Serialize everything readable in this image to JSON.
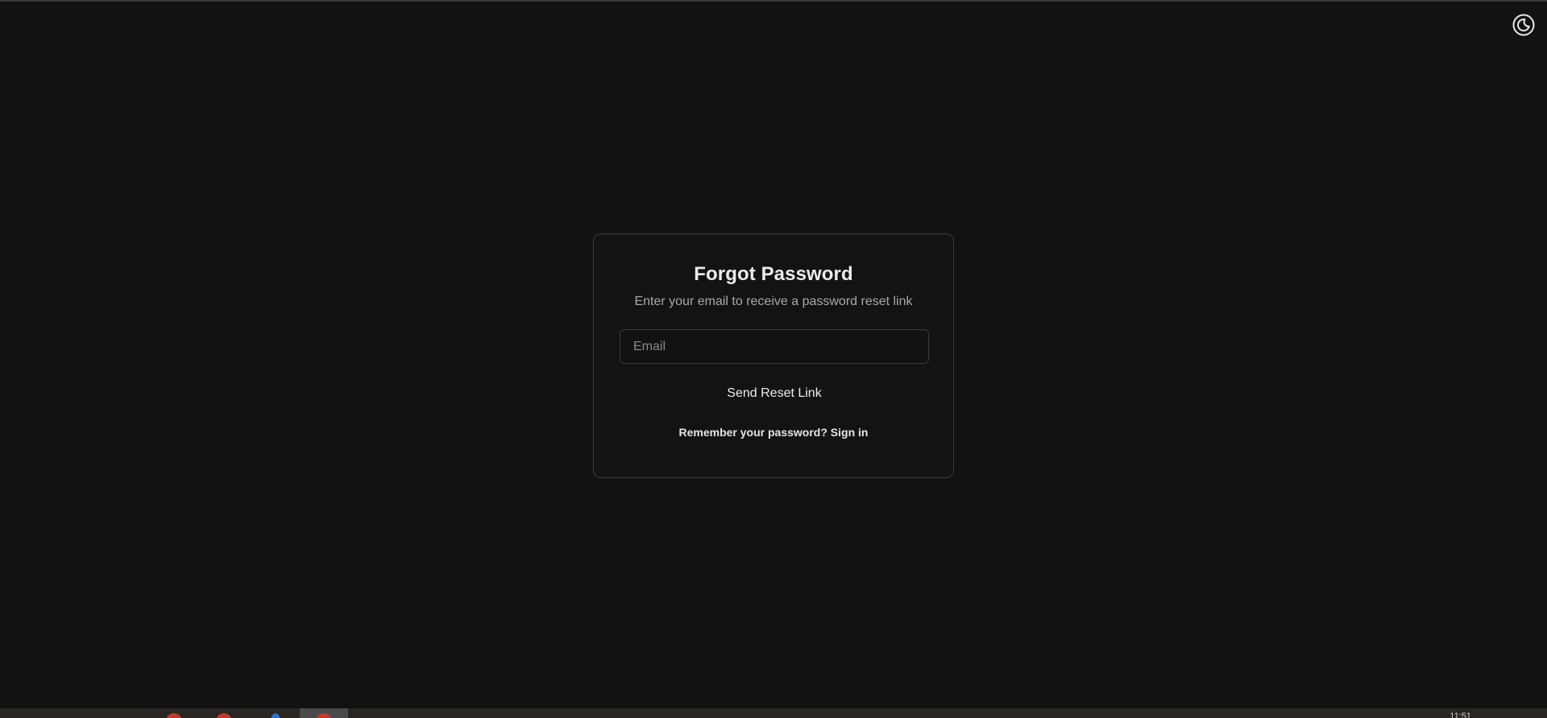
{
  "header": {
    "theme_toggle_icon": "moon-icon"
  },
  "forgot": {
    "title": "Forgot Password",
    "subtitle": "Enter your email to receive a password reset link",
    "email_placeholder": "Email",
    "email_value": "",
    "send_label": "Send Reset Link",
    "remember_text": "Remember your password?",
    "signin_label": "Sign in"
  },
  "taskbar": {
    "clock": "11:51"
  },
  "colors": {
    "background": "#121212",
    "card_border": "#3c3c3c",
    "text": "#ededed",
    "muted_text": "#a9a9a9"
  }
}
